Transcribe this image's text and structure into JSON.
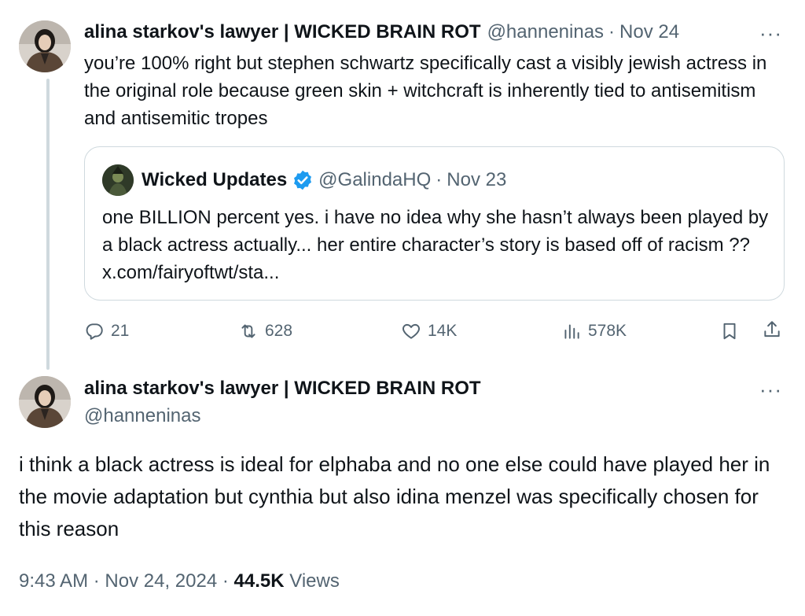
{
  "reply_tweet": {
    "display_name": "alina starkov's lawyer | WICKED BRAIN ROT",
    "handle": "@hanneninas",
    "separator": "·",
    "date": "Nov 24",
    "more": "···",
    "text": "you’re 100% right but stephen schwartz specifically cast a visibly jewish actress in the original role because green skin + witchcraft is inherently tied to antisemitism and antisemitic tropes",
    "quote": {
      "display_name": "Wicked Updates",
      "handle": "@GalindaHQ",
      "separator": "·",
      "date": "Nov 23",
      "verified": true,
      "text": "one BILLION percent yes. i have no idea why she hasn’t always been played by a black actress actually... her entire character’s story is based off of racism ?? x.com/fairyoftwt/sta..."
    },
    "actions": {
      "replies": "21",
      "reposts": "628",
      "likes": "14K",
      "views": "578K",
      "icons": [
        "reply-icon",
        "repost-icon",
        "like-icon",
        "views-icon",
        "bookmark-icon",
        "share-icon"
      ]
    }
  },
  "main_tweet": {
    "display_name": "alina starkov's lawyer | WICKED BRAIN ROT",
    "handle": "@hanneninas",
    "more": "···",
    "text": "i think a black actress is ideal for elphaba and no one else could have played her in the movie adaptation but cynthia but also idina menzel was specifically chosen for this reason",
    "time": "9:43 AM",
    "separator": "·",
    "date": "Nov 24, 2024",
    "views_count": "44.5K",
    "views_label": "Views"
  },
  "colors": {
    "text": "#0f1419",
    "muted": "#536471",
    "border": "#cfd9de",
    "verified": "#1d9bf0"
  }
}
